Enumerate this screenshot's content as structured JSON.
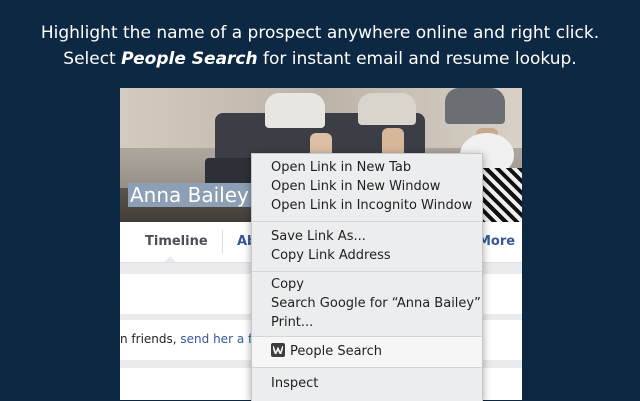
{
  "headline": {
    "line1": "Highlight the name of a prospect anywhere online and right click.",
    "line2_prefix": "Select ",
    "line2_em": "People Search",
    "line2_suffix": " for instant email and resume lookup."
  },
  "profile": {
    "name": "Anna Bailey",
    "tabs": [
      "Timeline",
      "Ab",
      "More ▾"
    ],
    "friends_prefix": "n friends, ",
    "friends_link": "send her a f"
  },
  "context_menu": {
    "group1": [
      "Open Link in New Tab",
      "Open Link in New Window",
      "Open Link in Incognito Window"
    ],
    "group2": [
      "Save Link As...",
      "Copy Link Address"
    ],
    "group3": [
      "Copy",
      "Search Google for “Anna Bailey”",
      "Print..."
    ],
    "people_search": "People Search",
    "inspect": "Inspect"
  },
  "colors": {
    "background": "#0d2843",
    "highlight": "#8d9fb5",
    "link": "#365899"
  }
}
